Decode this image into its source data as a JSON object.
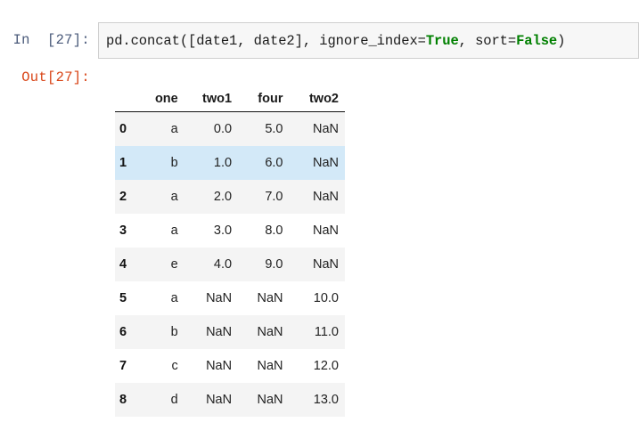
{
  "notebook": {
    "input_prompt": "In  [27]:",
    "output_prompt": "Out[27]:",
    "code": {
      "full_text": "pd.concat([date1, date2], ignore_index=True, sort=False)",
      "segments": [
        {
          "text": "pd.concat([date1, date2], ignore_index=",
          "type": "plain"
        },
        {
          "text": "True",
          "type": "keyword"
        },
        {
          "text": ", sort=",
          "type": "plain"
        },
        {
          "text": "False",
          "type": "keyword"
        },
        {
          "text": ")",
          "type": "plain"
        }
      ]
    },
    "colors": {
      "input_prompt": "#4a5a7a",
      "output_prompt": "#D84315",
      "keyword": "#008000",
      "cell_background": "#f7f7f7",
      "cell_border": "#cfcfcf",
      "row_stripe": "#f4f4f4",
      "row_highlight": "#d3e9f8",
      "header_rule": "#111111"
    }
  },
  "chart_data": {
    "type": "table",
    "title": "",
    "index_name": "",
    "columns": [
      "one",
      "two1",
      "four",
      "two2"
    ],
    "index": [
      "0",
      "1",
      "2",
      "3",
      "4",
      "5",
      "6",
      "7",
      "8"
    ],
    "rows": [
      {
        "index": "0",
        "cells": [
          "a",
          "0.0",
          "5.0",
          "NaN"
        ],
        "style": "stripe"
      },
      {
        "index": "1",
        "cells": [
          "b",
          "1.0",
          "6.0",
          "NaN"
        ],
        "style": "hl"
      },
      {
        "index": "2",
        "cells": [
          "a",
          "2.0",
          "7.0",
          "NaN"
        ],
        "style": "stripe"
      },
      {
        "index": "3",
        "cells": [
          "a",
          "3.0",
          "8.0",
          "NaN"
        ],
        "style": "plain"
      },
      {
        "index": "4",
        "cells": [
          "e",
          "4.0",
          "9.0",
          "NaN"
        ],
        "style": "stripe"
      },
      {
        "index": "5",
        "cells": [
          "a",
          "NaN",
          "NaN",
          "10.0"
        ],
        "style": "plain"
      },
      {
        "index": "6",
        "cells": [
          "b",
          "NaN",
          "NaN",
          "11.0"
        ],
        "style": "stripe"
      },
      {
        "index": "7",
        "cells": [
          "c",
          "NaN",
          "NaN",
          "12.0"
        ],
        "style": "plain"
      },
      {
        "index": "8",
        "cells": [
          "d",
          "NaN",
          "NaN",
          "13.0"
        ],
        "style": "stripe"
      }
    ]
  }
}
